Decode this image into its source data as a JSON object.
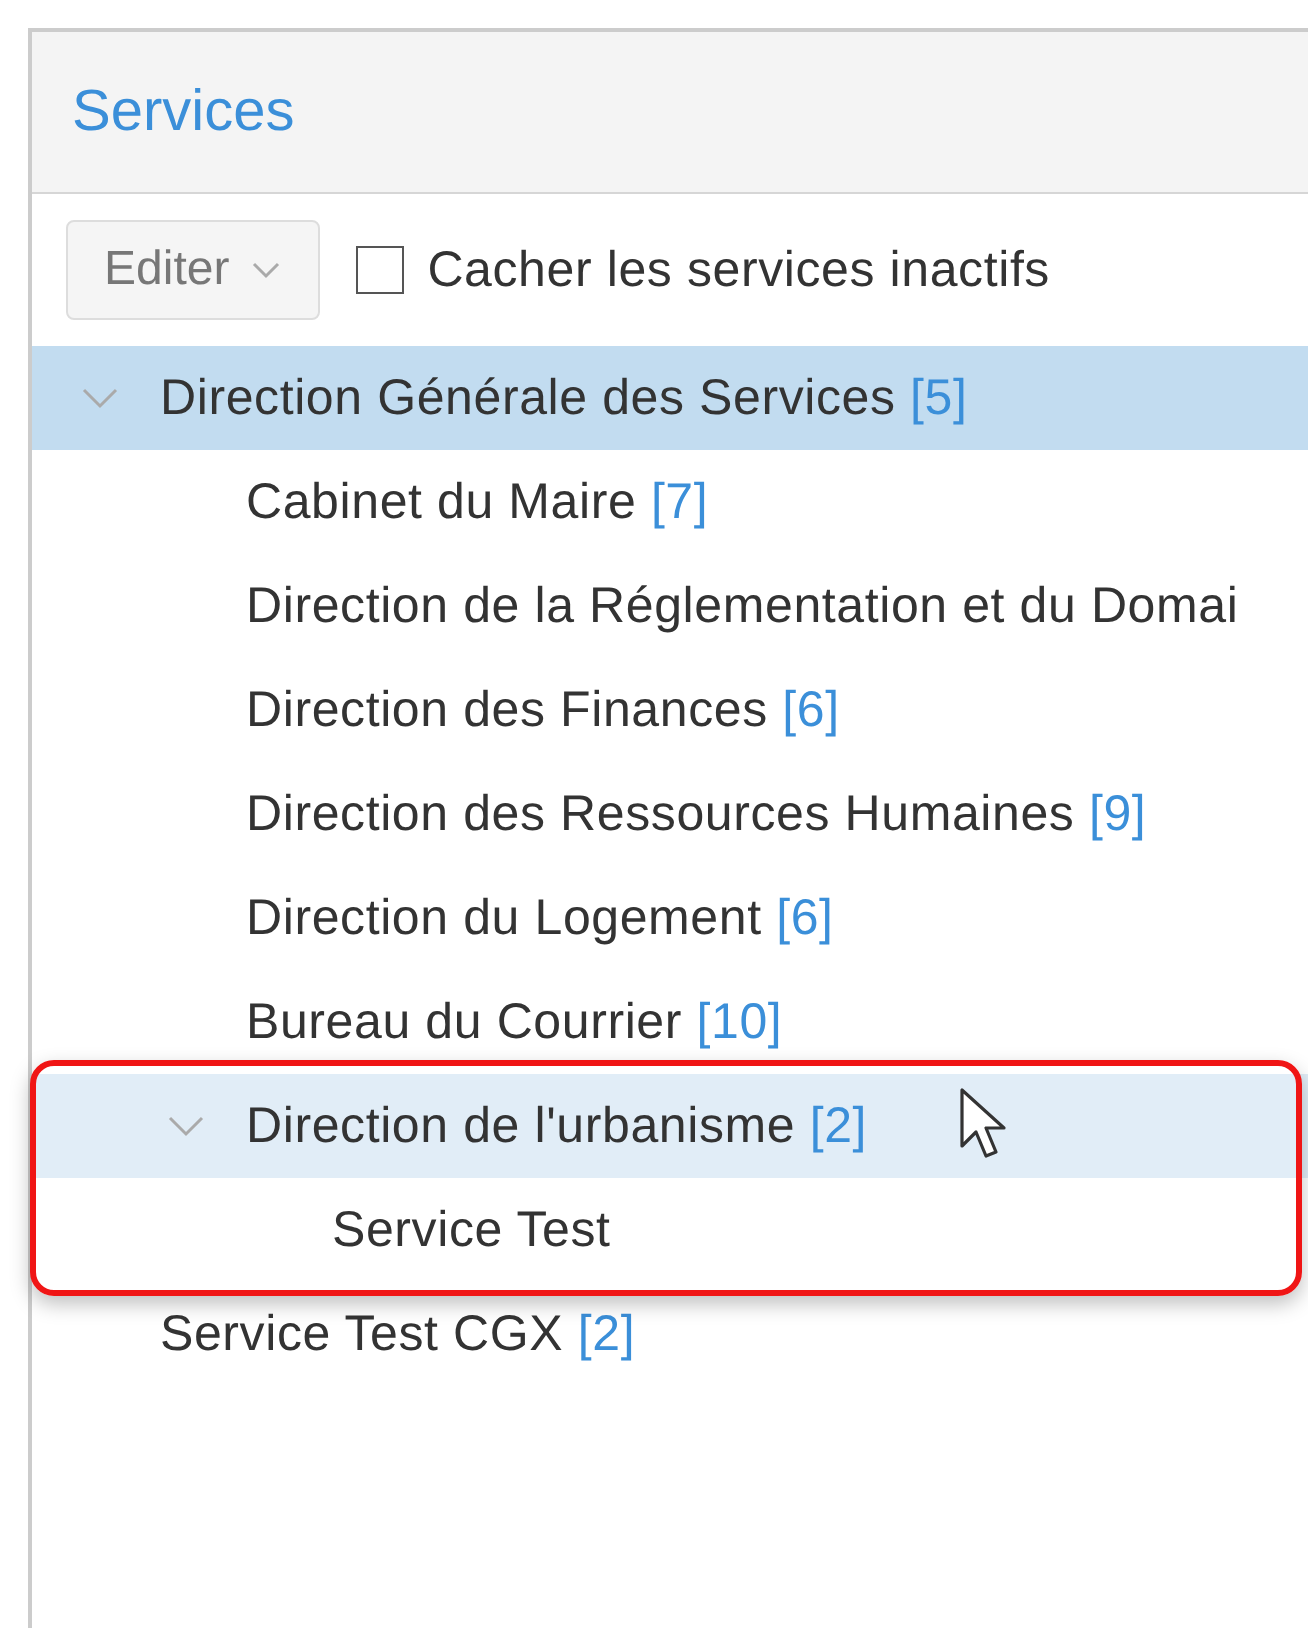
{
  "panel": {
    "title": "Services"
  },
  "toolbar": {
    "edit_button": "Editer",
    "hide_inactive": {
      "label": "Cacher les services inactifs",
      "checked": false
    }
  },
  "tree": [
    {
      "name": "Direction Générale des Services",
      "count": "[5]",
      "selected": true,
      "hovered": false,
      "expanded": true,
      "children": [
        {
          "name": "Cabinet du Maire",
          "count": "[7]",
          "selected": false,
          "hovered": false
        },
        {
          "name": "Direction de la Réglementation et du Domai",
          "selected": false,
          "hovered": false
        },
        {
          "name": "Direction des Finances",
          "count": "[6]",
          "selected": false,
          "hovered": false
        },
        {
          "name": "Direction des Ressources Humaines",
          "count": "[9]",
          "selected": false,
          "hovered": false
        },
        {
          "name": "Direction du Logement",
          "count": "[6]",
          "selected": false,
          "hovered": false
        },
        {
          "name": "Bureau du Courrier",
          "count": "[10]",
          "selected": false,
          "hovered": false
        },
        {
          "name": "Direction de l'urbanisme",
          "count": "[2]",
          "selected": false,
          "hovered": true,
          "expanded": true,
          "children": [
            {
              "name": "Service Test",
              "selected": false,
              "hovered": false
            }
          ]
        }
      ]
    },
    {
      "name": "Service Test CGX",
      "count": "[2]",
      "selected": false,
      "hovered": false
    }
  ]
}
